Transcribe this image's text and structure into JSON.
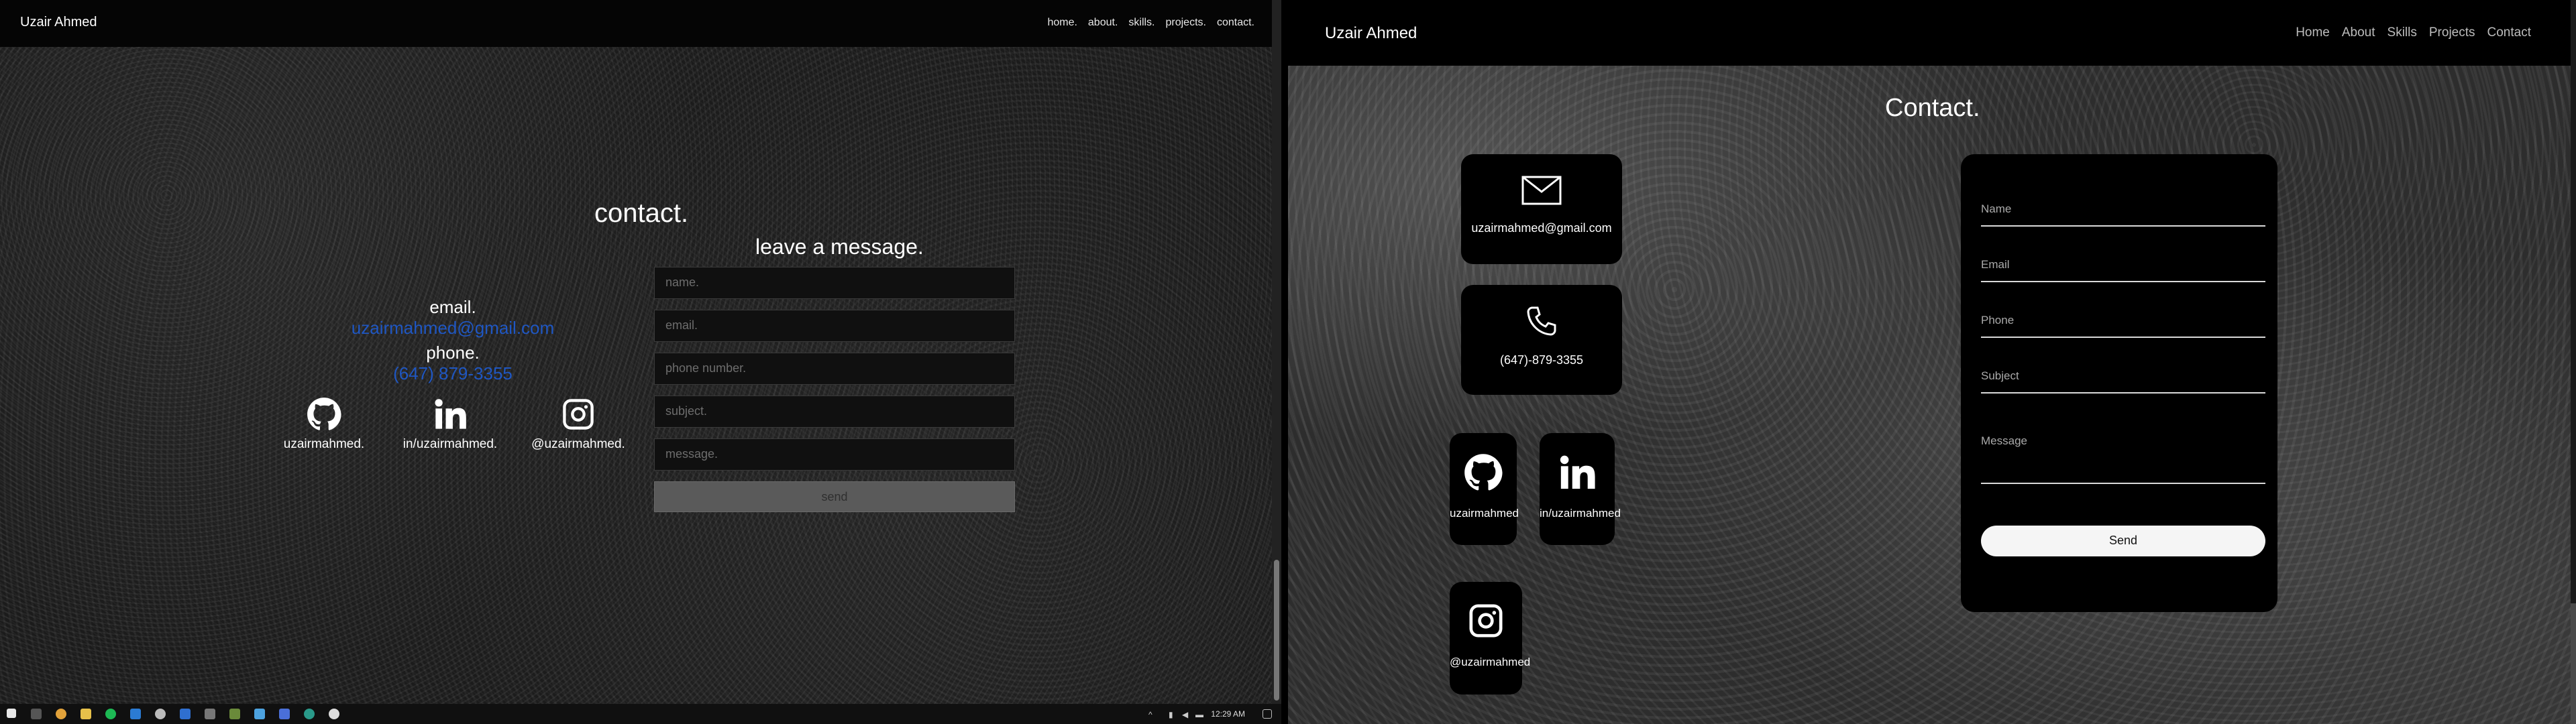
{
  "left": {
    "brand": "Uzair Ahmed",
    "nav": [
      "home.",
      "about.",
      "skills.",
      "projects.",
      "contact."
    ],
    "title": "contact.",
    "email_label": "email.",
    "email_value": "uzairmahmed@gmail.com",
    "phone_label": "phone.",
    "phone_value": "(647) 879-3355",
    "socials": [
      {
        "name": "github",
        "text": "uzairmahmed."
      },
      {
        "name": "linkedin",
        "text": "in/uzairmahmed."
      },
      {
        "name": "instagram",
        "text": "@uzairmahmed."
      }
    ],
    "form_title": "leave a message.",
    "placeholders": {
      "name": "name.",
      "email": "email.",
      "phone": "phone number.",
      "subject": "subject.",
      "message": "message."
    },
    "send_label": "send",
    "taskbar": {
      "clock": "12:29 AM"
    }
  },
  "right": {
    "brand": "Uzair Ahmed",
    "nav": [
      "Home",
      "About",
      "Skills",
      "Projects",
      "Contact"
    ],
    "title": "Contact.",
    "email_value": "uzairmahmed@gmail.com",
    "phone_value": "(647)-879-3355",
    "socials": [
      {
        "name": "github",
        "text": "uzairmahmed"
      },
      {
        "name": "linkedin",
        "text": "in/uzairmahmed"
      },
      {
        "name": "instagram",
        "text": "@uzairmahmed"
      }
    ],
    "placeholders": {
      "name": "Name",
      "email": "Email",
      "phone": "Phone",
      "subject": "Subject",
      "message": "Message"
    },
    "send_label": "Send"
  },
  "colors": {
    "link_blue": "#1f57c3",
    "card_bg": "#000000"
  }
}
